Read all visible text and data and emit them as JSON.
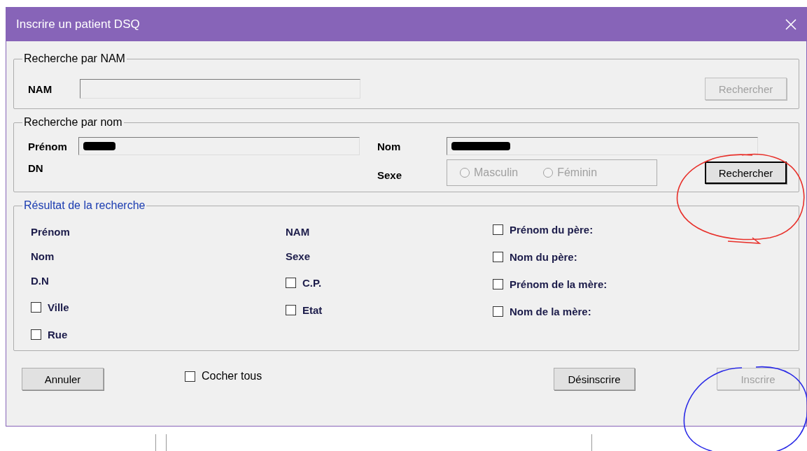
{
  "window": {
    "title": "Inscrire un patient DSQ"
  },
  "nam_search": {
    "legend": "Recherche par NAM",
    "label": "NAM",
    "button": {
      "label": "Rechercher",
      "disabled": true
    }
  },
  "name_search": {
    "legend": "Recherche par nom",
    "first_name": {
      "label": "Prénom",
      "redacted": true
    },
    "last_name": {
      "label": "Nom",
      "redacted": true
    },
    "dob": {
      "label": "DN"
    },
    "sex": {
      "label": "Sexe",
      "options": [
        {
          "label": "Masculin",
          "selected": false,
          "disabled": true
        },
        {
          "label": "Féminin",
          "selected": false,
          "disabled": true
        }
      ]
    },
    "button": {
      "label": "Rechercher",
      "disabled": false
    }
  },
  "results": {
    "legend": "Résultat de la recherche",
    "columns": [
      [
        {
          "kind": "label",
          "label": "Prénom"
        },
        {
          "kind": "label",
          "label": "Nom"
        },
        {
          "kind": "label",
          "label": "D.N"
        },
        {
          "kind": "checkbox",
          "label": "Ville",
          "checked": false
        },
        {
          "kind": "checkbox",
          "label": "Rue",
          "checked": false
        }
      ],
      [
        {
          "kind": "label",
          "label": "NAM"
        },
        {
          "kind": "label",
          "label": "Sexe"
        },
        {
          "kind": "checkbox",
          "label": "C.P.",
          "checked": false
        },
        {
          "kind": "checkbox",
          "label": "Etat",
          "checked": false
        }
      ],
      [
        {
          "kind": "checkbox",
          "label": "Prénom du père:",
          "checked": false
        },
        {
          "kind": "checkbox",
          "label": "Nom du père:",
          "checked": false
        },
        {
          "kind": "checkbox",
          "label": "Prénom de la mère:",
          "checked": false
        },
        {
          "kind": "checkbox",
          "label": "Nom de la mère:",
          "checked": false
        }
      ]
    ]
  },
  "footer": {
    "cancel": {
      "label": "Annuler",
      "disabled": false
    },
    "check_all": {
      "label": "Cocher tous",
      "checked": false
    },
    "unregister": {
      "label": "Désinscrire",
      "disabled": false
    },
    "register": {
      "label": "Inscrire",
      "disabled": true
    }
  },
  "annotations": [
    {
      "kind": "circle",
      "color": "#e8302a"
    },
    {
      "kind": "circle",
      "color": "#2a2ae6"
    }
  ]
}
